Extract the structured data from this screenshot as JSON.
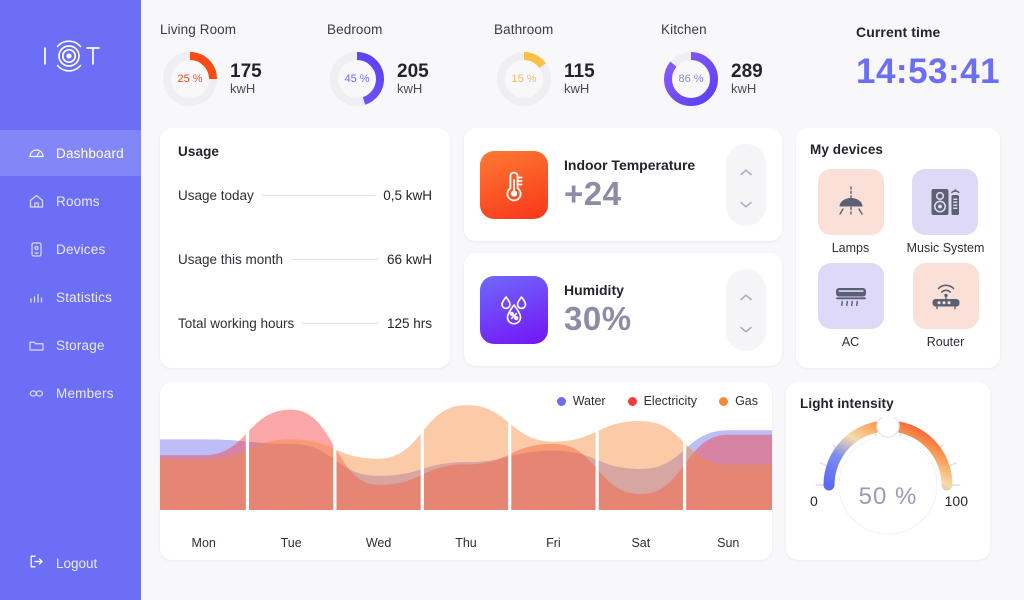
{
  "sidebar": {
    "logo_text": "IOT",
    "logo_icon": "iot-logo-icon",
    "items": [
      {
        "label": "Dashboard",
        "icon": "dashboard-icon",
        "active": true
      },
      {
        "label": "Rooms",
        "icon": "home-icon",
        "active": false
      },
      {
        "label": "Devices",
        "icon": "device-icon",
        "active": false
      },
      {
        "label": "Statistics",
        "icon": "bar-chart-icon",
        "active": false
      },
      {
        "label": "Storage",
        "icon": "folder-icon",
        "active": false
      },
      {
        "label": "Members",
        "icon": "members-icon",
        "active": false
      }
    ],
    "logout": {
      "label": "Logout",
      "icon": "logout-icon"
    }
  },
  "rooms": [
    {
      "name": "Living Room",
      "percent": "25 %",
      "percent_value": 25,
      "value": "175",
      "unit": "kwH",
      "color": "#fa4b16",
      "color2": "#ff6a2a"
    },
    {
      "name": "Bedroom",
      "percent": "45 %",
      "percent_value": 45,
      "value": "205",
      "unit": "kwH",
      "color": "#5b3ff0",
      "color2": "#7b5cfa"
    },
    {
      "name": "Bathroom",
      "percent": "15 %",
      "percent_value": 15,
      "value": "115",
      "unit": "kwH",
      "color": "#fbbf45",
      "color2": "#fdd06a"
    },
    {
      "name": "Kitchen",
      "percent": "86 %",
      "percent_value": 86,
      "value": "289",
      "unit": "kwH",
      "color": "#5b3ff0",
      "color2": "#8b5cfb"
    }
  ],
  "clock": {
    "label": "Current time",
    "time": "14:53:41",
    "color": "#6c6ff5"
  },
  "usage": {
    "title": "Usage",
    "rows": [
      {
        "label": "Usage today",
        "value": "0,5 kwH"
      },
      {
        "label": "Usage this month",
        "value": "66 kwH"
      },
      {
        "label": "Total working hours",
        "value": "125 hrs"
      }
    ]
  },
  "sensors": [
    {
      "label": "Indoor Temperature",
      "value": "+24",
      "icon": "thermometer-icon",
      "up": "increase-temperature",
      "down": "decrease-temperature"
    },
    {
      "label": "Humidity",
      "value": "30%",
      "icon": "humidity-drop-icon",
      "up": "increase-humidity",
      "down": "decrease-humidity"
    }
  ],
  "devices": {
    "title": "My devices",
    "items": [
      {
        "label": "Lamps",
        "icon": "lamp-icon",
        "tone": "pink"
      },
      {
        "label": "Music System",
        "icon": "speaker-icon",
        "tone": "lav"
      },
      {
        "label": "AC",
        "icon": "air-conditioner-icon",
        "tone": "lav"
      },
      {
        "label": "Router",
        "icon": "router-icon",
        "tone": "pink"
      }
    ]
  },
  "light": {
    "title": "Light intensity",
    "min": "0",
    "max": "100",
    "value": "50 %",
    "value_number": 50
  },
  "chart_data": {
    "type": "area",
    "title": "",
    "xlabel": "",
    "ylabel": "",
    "categories": [
      "Mon",
      "Tue",
      "Wed",
      "Thu",
      "Fri",
      "Sat",
      "Sun"
    ],
    "ylim": [
      0,
      100
    ],
    "grid": true,
    "legend_position": "top-right",
    "series": [
      {
        "name": "Water",
        "color": "#6c6cf0",
        "values": [
          62,
          58,
          30,
          42,
          52,
          36,
          70
        ]
      },
      {
        "name": "Electricity",
        "color": "#f63b3b",
        "values": [
          48,
          88,
          22,
          40,
          58,
          14,
          66
        ]
      },
      {
        "name": "Gas",
        "color": "#f7893b",
        "values": [
          44,
          62,
          45,
          92,
          60,
          78,
          40
        ]
      }
    ]
  }
}
